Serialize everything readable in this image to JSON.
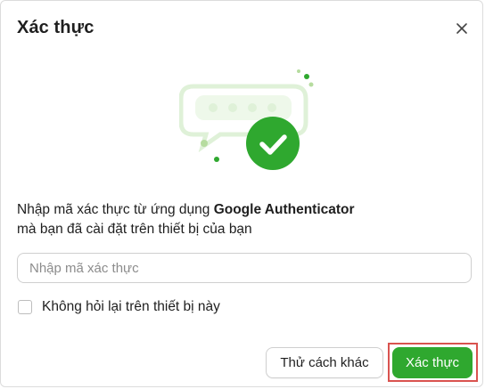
{
  "dialog": {
    "title": "Xác thực",
    "close_icon": "close-icon",
    "illustration_icon": "verified-chat-check-icon",
    "description_prefix": "Nhập mã xác thực từ ứng dụng ",
    "description_app": "Google Authenticator",
    "description_suffix": "mà bạn đã cài đặt trên thiết bị của bạn",
    "code_input": {
      "placeholder": "Nhập mã xác thực",
      "value": ""
    },
    "remember_device": {
      "label": "Không hỏi lại trên thiết bị này",
      "checked": false
    },
    "buttons": {
      "secondary_label": "Thử cách khác",
      "primary_label": "Xác thực"
    }
  },
  "colors": {
    "primary": "#2fa82f",
    "illustration_light": "#dff1d8",
    "highlight_border": "#d9534f"
  }
}
